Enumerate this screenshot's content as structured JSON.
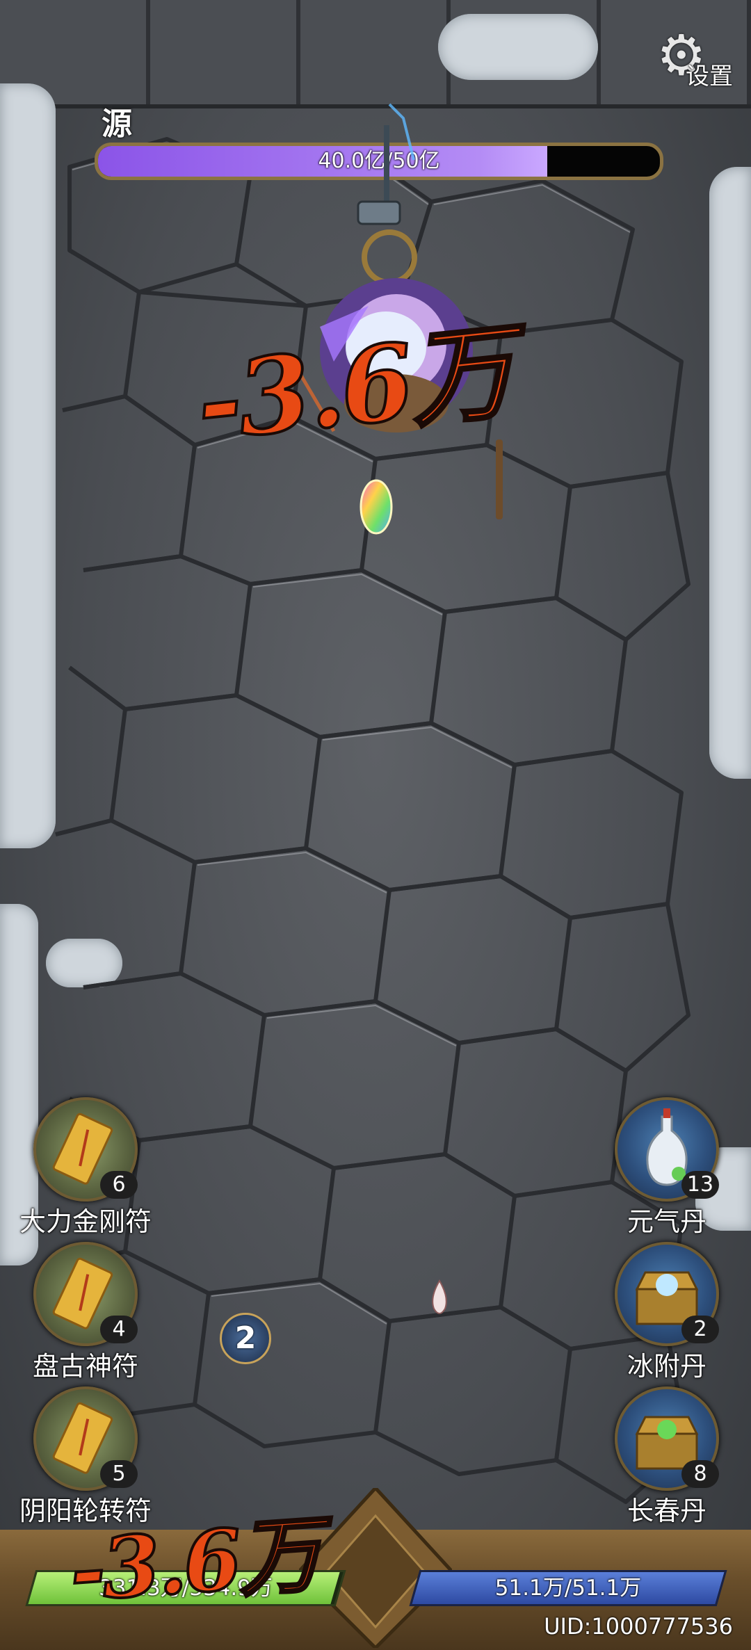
{
  "settings": {
    "label": "设置",
    "icon": "gear-icon"
  },
  "boss": {
    "name": "源",
    "hp_text": "40.0亿/50亿",
    "hp_current": 40.0,
    "hp_max": 50,
    "hp_fraction": 0.8
  },
  "damage": {
    "boss_hit": "-3.6万",
    "player_hit": "-3.6万"
  },
  "combo": {
    "value": "2"
  },
  "skills_left": [
    {
      "name": "大力金刚符",
      "count": "6",
      "icon": "talisman-icon"
    },
    {
      "name": "盘古神符",
      "count": "4",
      "icon": "talisman-icon"
    },
    {
      "name": "阴阳轮转符",
      "count": "5",
      "icon": "talisman-icon"
    }
  ],
  "skills_right": [
    {
      "name": "元气丹",
      "count": "13",
      "icon": "vase-icon"
    },
    {
      "name": "冰附丹",
      "count": "2",
      "icon": "treasure-chest-icon"
    },
    {
      "name": "长春丹",
      "count": "8",
      "icon": "treasure-chest-icon"
    }
  ],
  "player": {
    "hp_text": "331.3万/334.9万",
    "hp_fraction": 0.989,
    "mp_text": "51.1万/51.1万",
    "mp_fraction": 1.0
  },
  "uid": "UID:1000777536",
  "colors": {
    "boss_hp": "#9b6af0",
    "player_hp": "#8ed857",
    "player_mp": "#3a5cbf",
    "damage": "#e84a14"
  }
}
